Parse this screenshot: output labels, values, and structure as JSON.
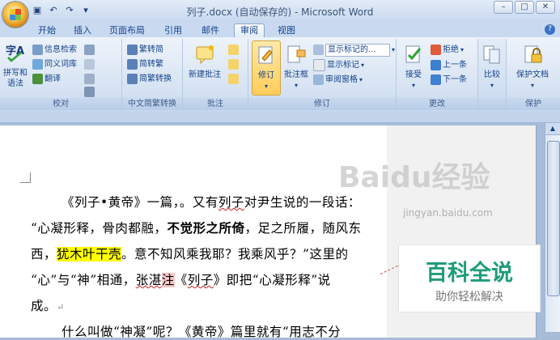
{
  "window": {
    "title": "列子.docx (自动保存的) - Microsoft Word",
    "controls": [
      "minimize",
      "restore",
      "close"
    ]
  },
  "quick_access": [
    "save-icon",
    "undo-icon",
    "redo-icon",
    "customize-icon"
  ],
  "tabs": [
    {
      "label": "开始",
      "active": false
    },
    {
      "label": "插入",
      "active": false
    },
    {
      "label": "页面布局",
      "active": false
    },
    {
      "label": "引用",
      "active": false
    },
    {
      "label": "邮件",
      "active": false
    },
    {
      "label": "审阅",
      "active": true
    },
    {
      "label": "视图",
      "active": false
    }
  ],
  "ribbon": {
    "groups": {
      "proofing": {
        "label": "校对",
        "spelling": "拼写和\n语法",
        "research": "信息检索",
        "thesaurus": "同义词库",
        "translate": "翻译"
      },
      "chinese": {
        "label": "中文简繁转换",
        "to_simplified": "繁转简",
        "to_traditional": "简转繁",
        "convert": "简繁转换"
      },
      "comments": {
        "label": "批注",
        "new_comment": "新建批注"
      },
      "tracking": {
        "label": "修订",
        "track_changes": "修订",
        "balloons": "批注框",
        "display_for_review": "显示标记的...",
        "show_markup": "显示标记",
        "reviewing_pane": "审阅窗格"
      },
      "changes": {
        "label": "更改",
        "accept": "接受",
        "reject": "拒绝",
        "previous": "上一条",
        "next": "下一条"
      },
      "compare": {
        "label": "",
        "compare": "比较"
      },
      "protect": {
        "label": "保护",
        "protect_document": "保护文档"
      }
    }
  },
  "document": {
    "lines": [
      {
        "parts": [
          {
            "t": "《列子•黄帝》一篇，。又有",
            "s": ""
          },
          {
            "t": "列子",
            "s": "wavy"
          },
          {
            "t": "对尹生说的一段话：",
            "s": ""
          }
        ]
      },
      {
        "parts": [
          {
            "t": "“心凝形释，骨肉都融，",
            "s": ""
          },
          {
            "t": "不觉形之所倚",
            "s": "bold"
          },
          {
            "t": "，足之所履，随风东",
            "s": ""
          }
        ]
      },
      {
        "parts": [
          {
            "t": "西，",
            "s": ""
          },
          {
            "t": "犹木叶干壳",
            "s": "hl"
          },
          {
            "t": "。意不知风乘我耶？我乘风乎？”这里的",
            "s": ""
          }
        ]
      },
      {
        "parts": [
          {
            "t": "“心”与“神”相通，",
            "s": ""
          },
          {
            "t": "张湛",
            "s": "wavy"
          },
          {
            "t": "注",
            "s": "comment"
          },
          {
            "t": "《",
            "s": ""
          },
          {
            "t": "列子",
            "s": "wavy"
          },
          {
            "t": "》即把“心凝形释”说",
            "s": ""
          }
        ]
      },
      {
        "parts": [
          {
            "t": "成。",
            "s": ""
          },
          {
            "t": "↵",
            "s": "para"
          }
        ]
      },
      {
        "parts": [
          {
            "t": "什么叫做“神凝”呢？《黄帝》篇里就有“用志不分",
            "s": ""
          }
        ]
      }
    ]
  },
  "watermark": {
    "text": "Baidu经验",
    "url": "jingyan.baidu.com"
  },
  "badge": {
    "title": "百科全说",
    "subtitle": "助你轻松解决"
  }
}
